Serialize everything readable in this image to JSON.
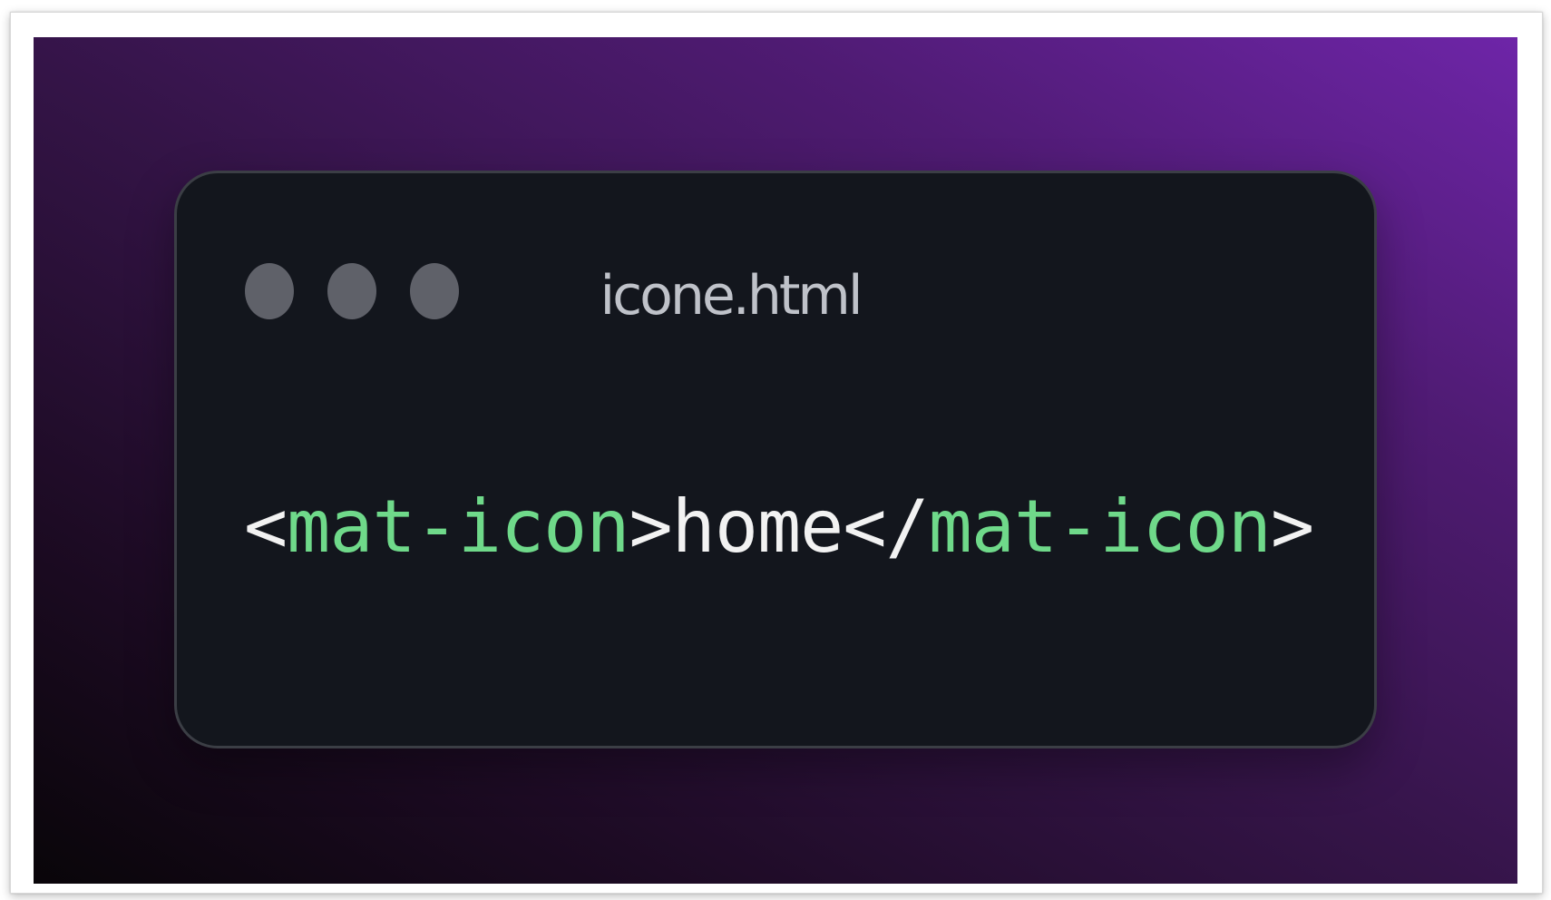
{
  "window": {
    "title": "icone.html",
    "controls": [
      "window-dot",
      "window-dot",
      "window-dot"
    ]
  },
  "code": {
    "open_bracket": "<",
    "open_tag": "mat-icon",
    "open_close": ">",
    "content": "home",
    "close_bracket": "</",
    "close_tag": "mat-icon",
    "close_close": ">"
  },
  "colors": {
    "background_start": "#090509",
    "background_end": "#6e25a8",
    "window_bg": "#13161d",
    "window_border": "#3b3e45",
    "dot": "#5f6169",
    "title": "#bfc2c9",
    "tag": "#6fd98a",
    "text": "#f2f2f2"
  }
}
